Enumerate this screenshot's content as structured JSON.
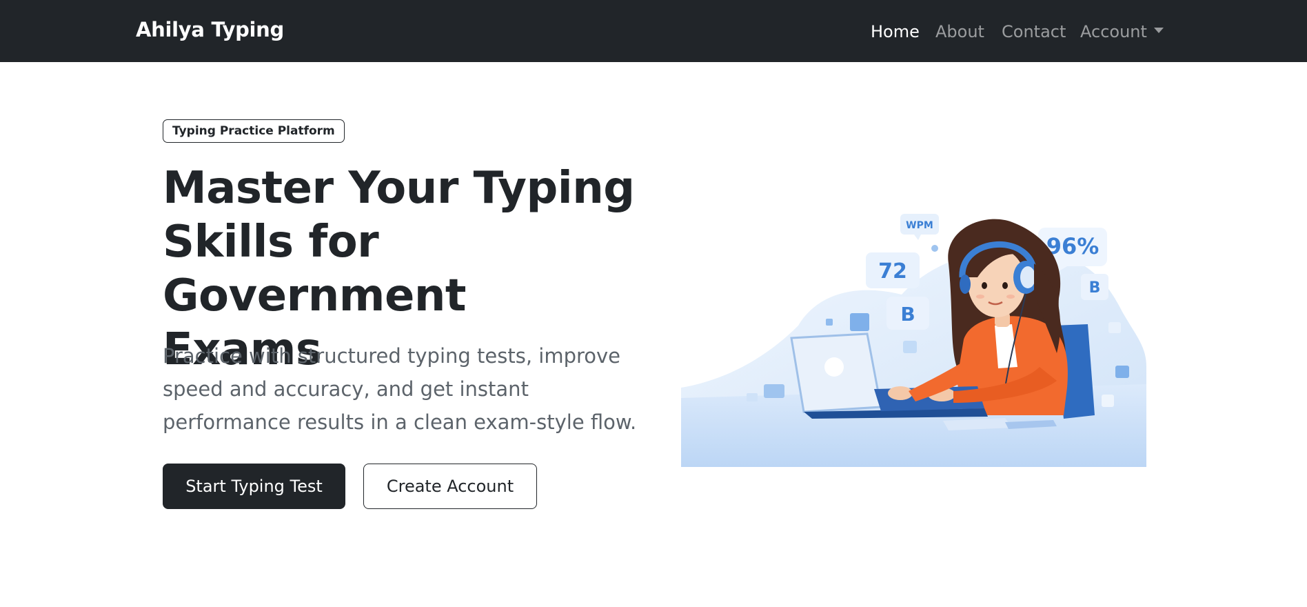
{
  "navbar": {
    "brand": "Ahilya Typing",
    "items": [
      {
        "label": "Home",
        "active": true
      },
      {
        "label": "About",
        "active": false
      },
      {
        "label": "Contact",
        "active": false
      },
      {
        "label": "Account",
        "active": false,
        "dropdown": true
      }
    ]
  },
  "hero": {
    "badge": "Typing Practice Platform",
    "title": "Master Your Typing Skills for Government Exams",
    "lead": "Practice with structured typing tests, improve speed and accuracy, and get instant performance results in a clean exam-style flow.",
    "primary_button": "Start Typing Test",
    "secondary_button": "Create Account"
  },
  "illustration": {
    "wpm_label": "WPM",
    "wpm_value": "72",
    "accuracy": "96%",
    "key_letter": "B",
    "icons": [
      "woman-typing-illustration",
      "headphones-icon",
      "laptop-icon"
    ]
  },
  "colors": {
    "navbar_bg": "#212529",
    "nav_active": "#ffffff",
    "nav_inactive": "rgba(255,255,255,0.55)",
    "primary": "#212529",
    "lead_text": "#5c636a",
    "illustration_blue": "#3b7fd4",
    "illustration_orange": "#f26a2e"
  }
}
